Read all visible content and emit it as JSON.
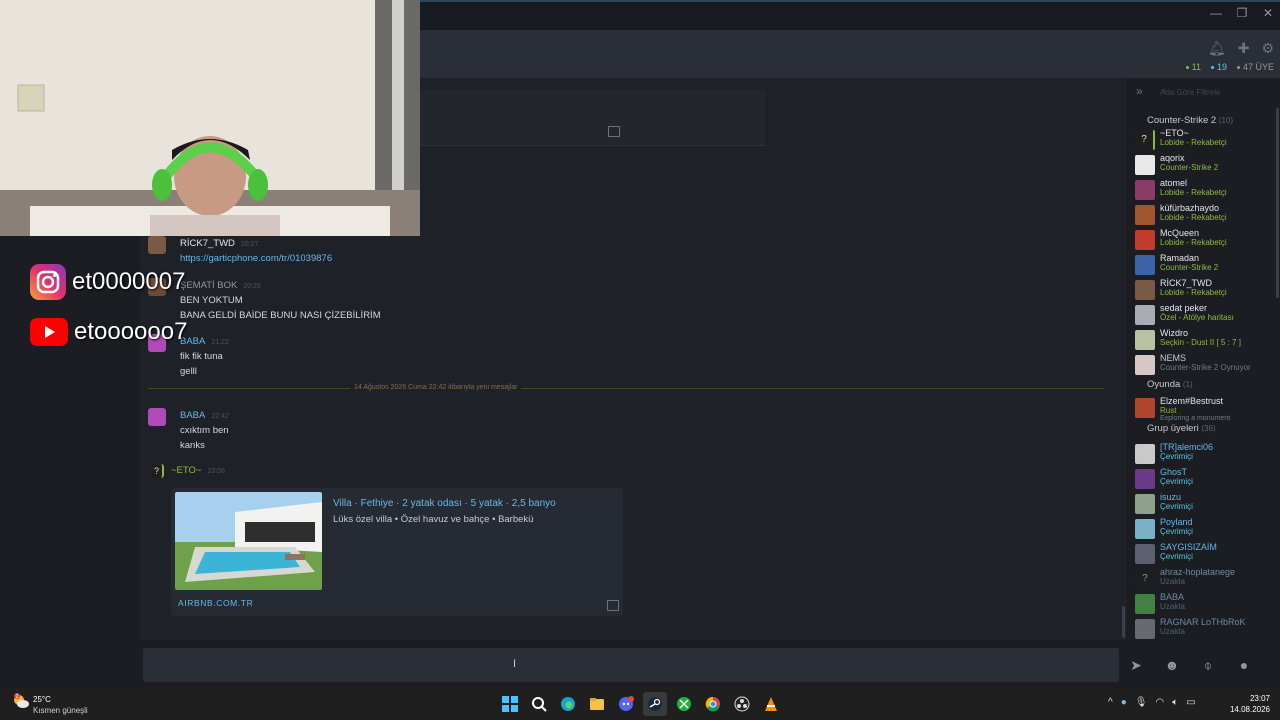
{
  "overlay": {
    "instagram_handle": "et0000007",
    "youtube_handle": "etoooooo7"
  },
  "header": {
    "online_count": "11",
    "ingame_count": "19",
    "member_count": "47 ÜYE"
  },
  "chat": {
    "messages": [
      {
        "author": "RİCK7_TWD",
        "time": "20:27",
        "lines": [
          "https://garticphone.com/tr/01039876"
        ],
        "author_color": "#e3e6ea"
      },
      {
        "author": "ŞEMATİ BOK",
        "time": "20:29",
        "lines": [
          "BEN YOKTUM",
          "BANA GELDİ BAİDE BUNU NASI ÇİZEBİLİRİM"
        ],
        "author_color": "#8f98a0"
      },
      {
        "author": "BABA",
        "time": "21:22",
        "lines": [
          "fik fik tuna",
          "gelll"
        ],
        "author_color": "#67b8e6"
      },
      {
        "author": "BABA",
        "time": "22:42",
        "lines": [
          "cxıktım ben",
          "kanks"
        ],
        "author_color": "#67b8e6"
      },
      {
        "author": "~ETO~",
        "time": "23:06",
        "lines": [],
        "author_color": "#90ba3c"
      }
    ],
    "divider": "14 Ağustos 2026 Cuma 22:42 itibarıyla yeni mesajlar",
    "embed": {
      "title": "Villa · Fethiye · 2 yatak odası · 5 yatak · 2,5 banyo",
      "description": "Lüks özel villa • Özel havuz ve bahçe • Barbekü",
      "site": "AIRBNB.COM.TR"
    }
  },
  "friends": {
    "search_placeholder": "Ada Göre Filtrele",
    "groups": [
      {
        "name": "Counter-Strike 2",
        "count": "(10)"
      },
      {
        "name": "Oyunda",
        "count": "(1)"
      },
      {
        "name": "Grup üyeleri",
        "count": "(36)"
      }
    ],
    "cs2": [
      {
        "name": "~ETO~",
        "status": "Lobide - Rekabetçi",
        "avatar": "#1f1f1f",
        "question": true
      },
      {
        "name": "aqorix",
        "status": "Counter-Strike 2",
        "avatar": "#e8e8e8"
      },
      {
        "name": "atomel",
        "status": "Lobide - Rekabetçi",
        "avatar": "#8a3b6a"
      },
      {
        "name": "küfürbazhaydo",
        "status": "Lobide - Rekabetçi",
        "avatar": "#a0552c"
      },
      {
        "name": "McQueen",
        "status": "Lobide - Rekabetçi",
        "avatar": "#c23b2b"
      },
      {
        "name": "Ramadan",
        "status": "Counter-Strike 2",
        "avatar": "#3a63a8"
      },
      {
        "name": "RİCK7_TWD",
        "status": "Lobide - Rekabetçi",
        "avatar": "#7a5a44"
      },
      {
        "name": "sedat peker",
        "status": "Özel - Atölye haritası",
        "avatar": "#a9adb3"
      },
      {
        "name": "Wizdro",
        "status": "Seçkin - Dust II [ 5 : 7 ]",
        "avatar": "#bac3a0"
      },
      {
        "name": "NEMS",
        "status": "Counter-Strike 2 Oynuyor",
        "avatar": "#d9c7c7",
        "faded": true
      }
    ],
    "ingame": [
      {
        "name": "Elzem#Bestrust",
        "status": "Rust",
        "extra": "Exploring a monument",
        "avatar": "#b0452c"
      }
    ],
    "members": [
      {
        "name": "[TR]alemci06",
        "status": "Çevrimiçi",
        "avatar": "#c9c9c9"
      },
      {
        "name": "GhosT",
        "status": "Çevrimiçi",
        "avatar": "#6a3a8a"
      },
      {
        "name": "isuzu",
        "status": "Çevrimiçi",
        "avatar": "#8fa08a"
      },
      {
        "name": "Poyland",
        "status": "Çevrimiçi",
        "avatar": "#7ab0c8"
      },
      {
        "name": "SAYGISIZAİM",
        "status": "Çevrimiçi",
        "avatar": "#5a6070"
      },
      {
        "name": "ahraz-hoplatanege",
        "status": "Uzakta",
        "avatar": "#1f1f1f",
        "question": true,
        "away": true
      },
      {
        "name": "BABA",
        "status": "Uzakta",
        "avatar": "#5fc35a",
        "away": true
      },
      {
        "name": "RAGNAR LoTHbRoK",
        "status": "Uzakta",
        "avatar": "#9aa0a6",
        "away": true
      }
    ]
  },
  "taskbar": {
    "temperature": "25°C",
    "weather": "Kısmen güneşli",
    "weather_badge": "2",
    "time": "23:07",
    "date": "14.08.2026",
    "apps": [
      "windows-start",
      "search",
      "edge",
      "file-explorer",
      "discord",
      "steam",
      "xbox",
      "chrome",
      "obs",
      "vlc"
    ]
  },
  "colors": {
    "accent_blue": "#67b8e6",
    "ingame_green": "#90ba3c",
    "online_blue": "#57cbde"
  }
}
